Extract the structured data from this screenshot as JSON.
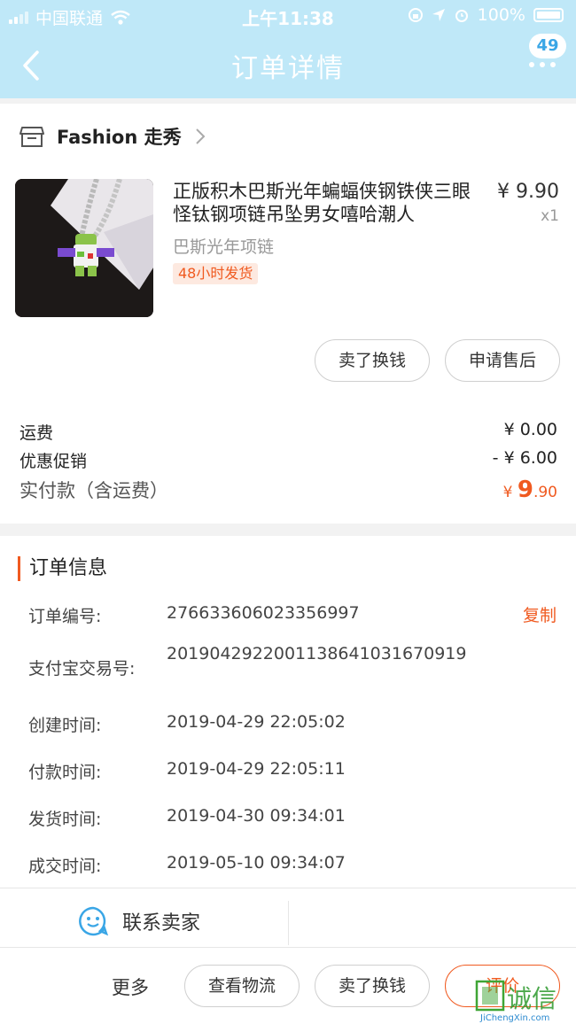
{
  "status_bar": {
    "carrier": "中国联通",
    "time": "上午11:38",
    "battery": "100%"
  },
  "nav": {
    "title": "订单详情",
    "more_badge": "49"
  },
  "shop": {
    "name": "Fashion 走秀"
  },
  "product": {
    "title": "正版积木巴斯光年蝙蝠侠钢铁侠三眼怪钛钢项链吊坠男女嘻哈潮人",
    "subtitle": "巴斯光年项链",
    "tag": "48小时发货",
    "price": "¥ 9.90",
    "qty": "x1"
  },
  "item_actions": {
    "sell": "卖了换钱",
    "after_sale": "申请售后"
  },
  "fees": {
    "shipping_label": "运费",
    "shipping_value": "¥ 0.00",
    "promo_label": "优惠促销",
    "promo_value": "- ¥ 6.00",
    "total_label": "实付款（含运费）",
    "total_symbol": "¥",
    "total_int": "9",
    "total_dec": ".90"
  },
  "order_info": {
    "section_title": "订单信息",
    "copy_label": "复制",
    "rows": [
      {
        "label": "订单编号:",
        "value": "276633606023356997"
      },
      {
        "label": "支付宝交易号:",
        "value": "2019042922001138641031670919"
      },
      {
        "label": "创建时间:",
        "value": "2019-04-29 22:05:02"
      },
      {
        "label": "付款时间:",
        "value": "2019-04-29 22:05:11"
      },
      {
        "label": "发货时间:",
        "value": "2019-04-30 09:34:01"
      },
      {
        "label": "成交时间:",
        "value": "2019-05-10 09:34:07"
      }
    ]
  },
  "contact": {
    "label": "联系卖家"
  },
  "bottom_bar": {
    "more": "更多",
    "logistics": "查看物流",
    "sell": "卖了换钱",
    "review": "评价"
  },
  "watermark": {
    "text": "集诚信",
    "url_text": "JiChengXin.com"
  },
  "colors": {
    "accent": "#f05a20",
    "header": "#bfe8f8",
    "link_blue": "#3aa6e6"
  }
}
